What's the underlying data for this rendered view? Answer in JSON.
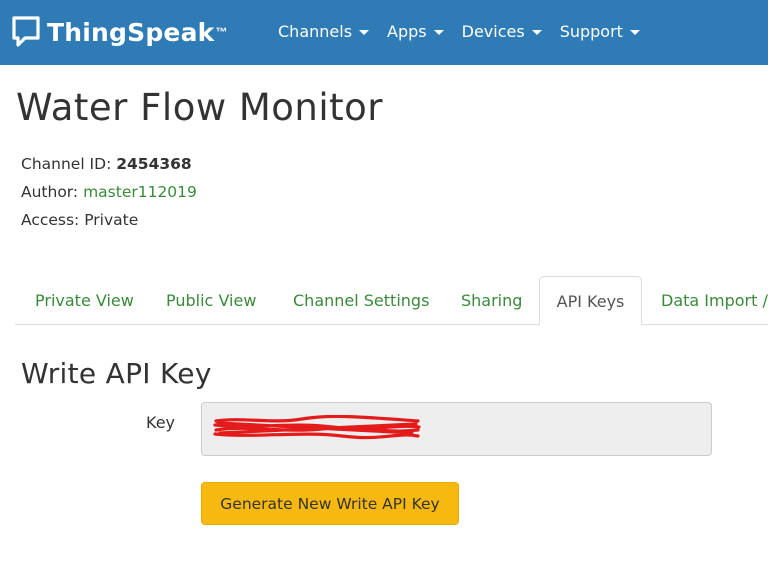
{
  "header": {
    "brand": "ThingSpeak",
    "brand_mark": "™",
    "brand_icon": "speech-bubble-icon",
    "menu": [
      {
        "label": "Channels"
      },
      {
        "label": "Apps"
      },
      {
        "label": "Devices"
      },
      {
        "label": "Support"
      }
    ],
    "bar_color": "#2f7bb5"
  },
  "channel": {
    "title": "Water Flow Monitor",
    "id_label": "Channel ID:",
    "id_value": "2454368",
    "author_label": "Author:",
    "author_value": "master112019",
    "access_label": "Access:",
    "access_value": "Private"
  },
  "tabs": [
    {
      "label": "Private View",
      "active": false
    },
    {
      "label": "Public View",
      "active": false
    },
    {
      "label": "Channel Settings",
      "active": false
    },
    {
      "label": "Sharing",
      "active": false
    },
    {
      "label": "API Keys",
      "active": true
    },
    {
      "label": "Data Import /",
      "active": false
    }
  ],
  "write_key": {
    "section_title": "Write API Key",
    "key_label": "Key",
    "key_value": "",
    "generate_label": "Generate New Write API Key",
    "button_color": "#f7b90f",
    "redaction_color": "#e31b1b"
  },
  "colors": {
    "link": "#3a8a3a",
    "text": "#333333"
  }
}
